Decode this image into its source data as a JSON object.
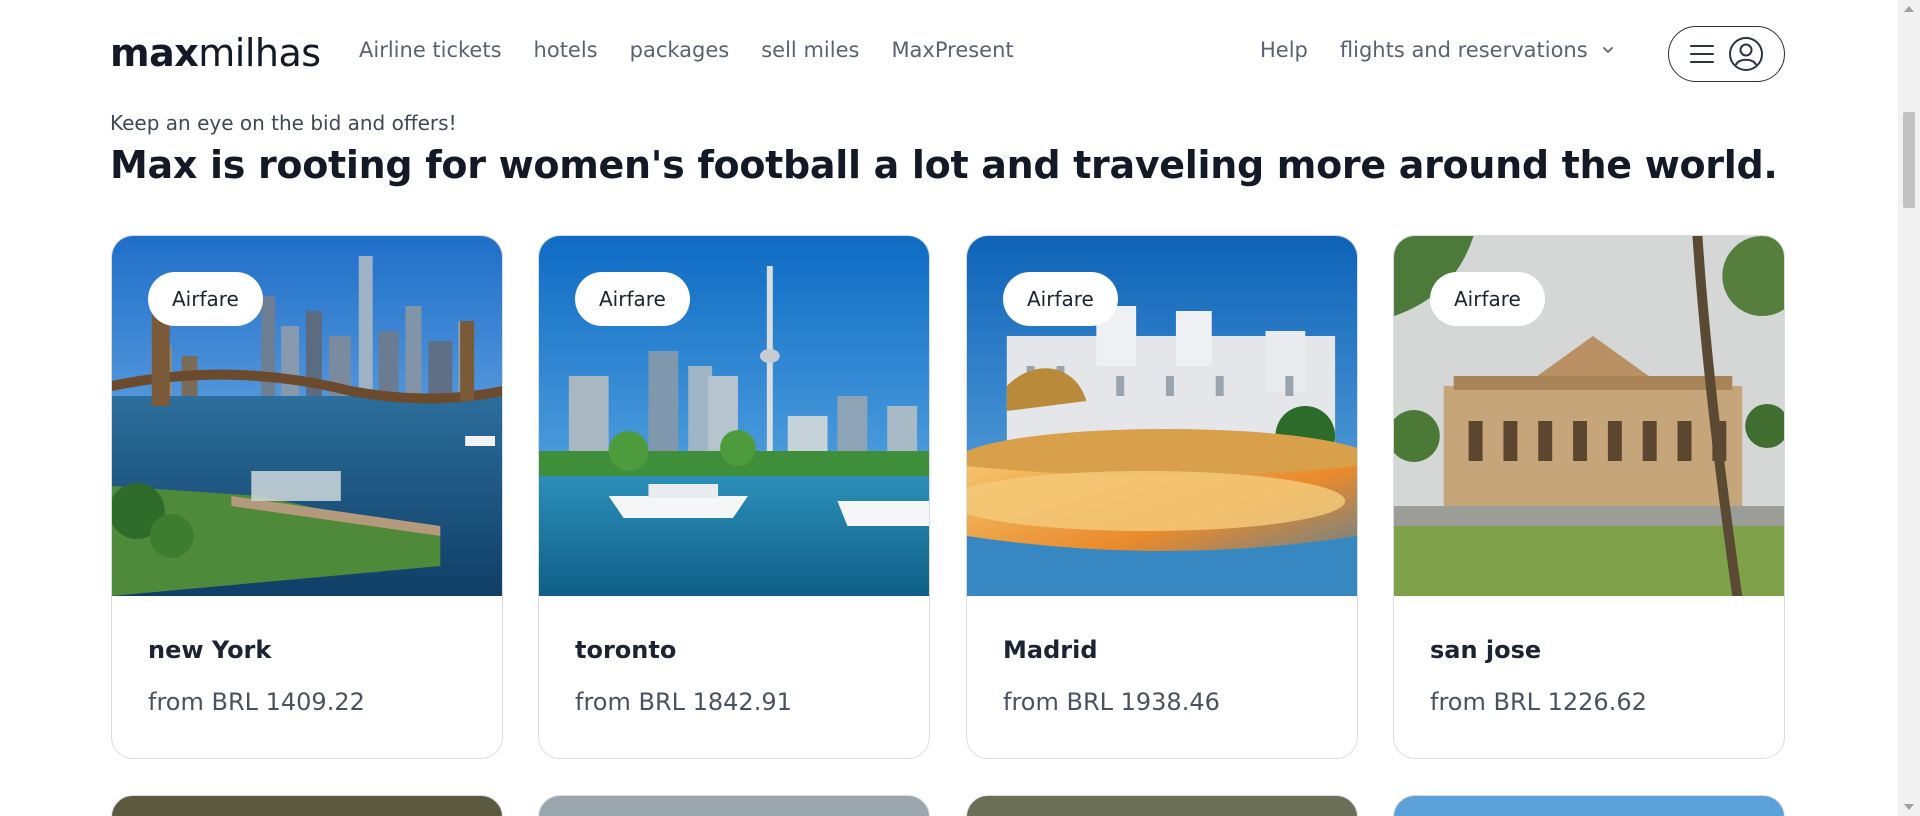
{
  "header": {
    "logo_bold": "max",
    "logo_light": "milhas",
    "nav": [
      {
        "label": "Airline tickets"
      },
      {
        "label": "hotels"
      },
      {
        "label": "packages"
      },
      {
        "label": "sell miles"
      },
      {
        "label": "MaxPresent"
      }
    ],
    "help_label": "Help",
    "flights_label": "flights and reservations",
    "flights_icon": "chevron-down-icon",
    "menu_icons": [
      "hamburger-menu-icon",
      "user-avatar-icon"
    ]
  },
  "section": {
    "eyebrow": "Keep an eye on the bid and offers!",
    "title": "Max is rooting for women's football a lot and traveling more around the world."
  },
  "cards": [
    {
      "badge": "Airfare",
      "city": "new York",
      "price": "from BRL 1409.22"
    },
    {
      "badge": "Airfare",
      "city": "toronto",
      "price": "from BRL 1842.91"
    },
    {
      "badge": "Airfare",
      "city": "Madrid",
      "price": "from BRL 1938.46"
    },
    {
      "badge": "Airfare",
      "city": "san jose",
      "price": "from BRL 1226.62"
    }
  ],
  "colors": {
    "text_dark": "#131a26",
    "text_muted": "#5a6270",
    "card_border": "#d9dde3"
  }
}
